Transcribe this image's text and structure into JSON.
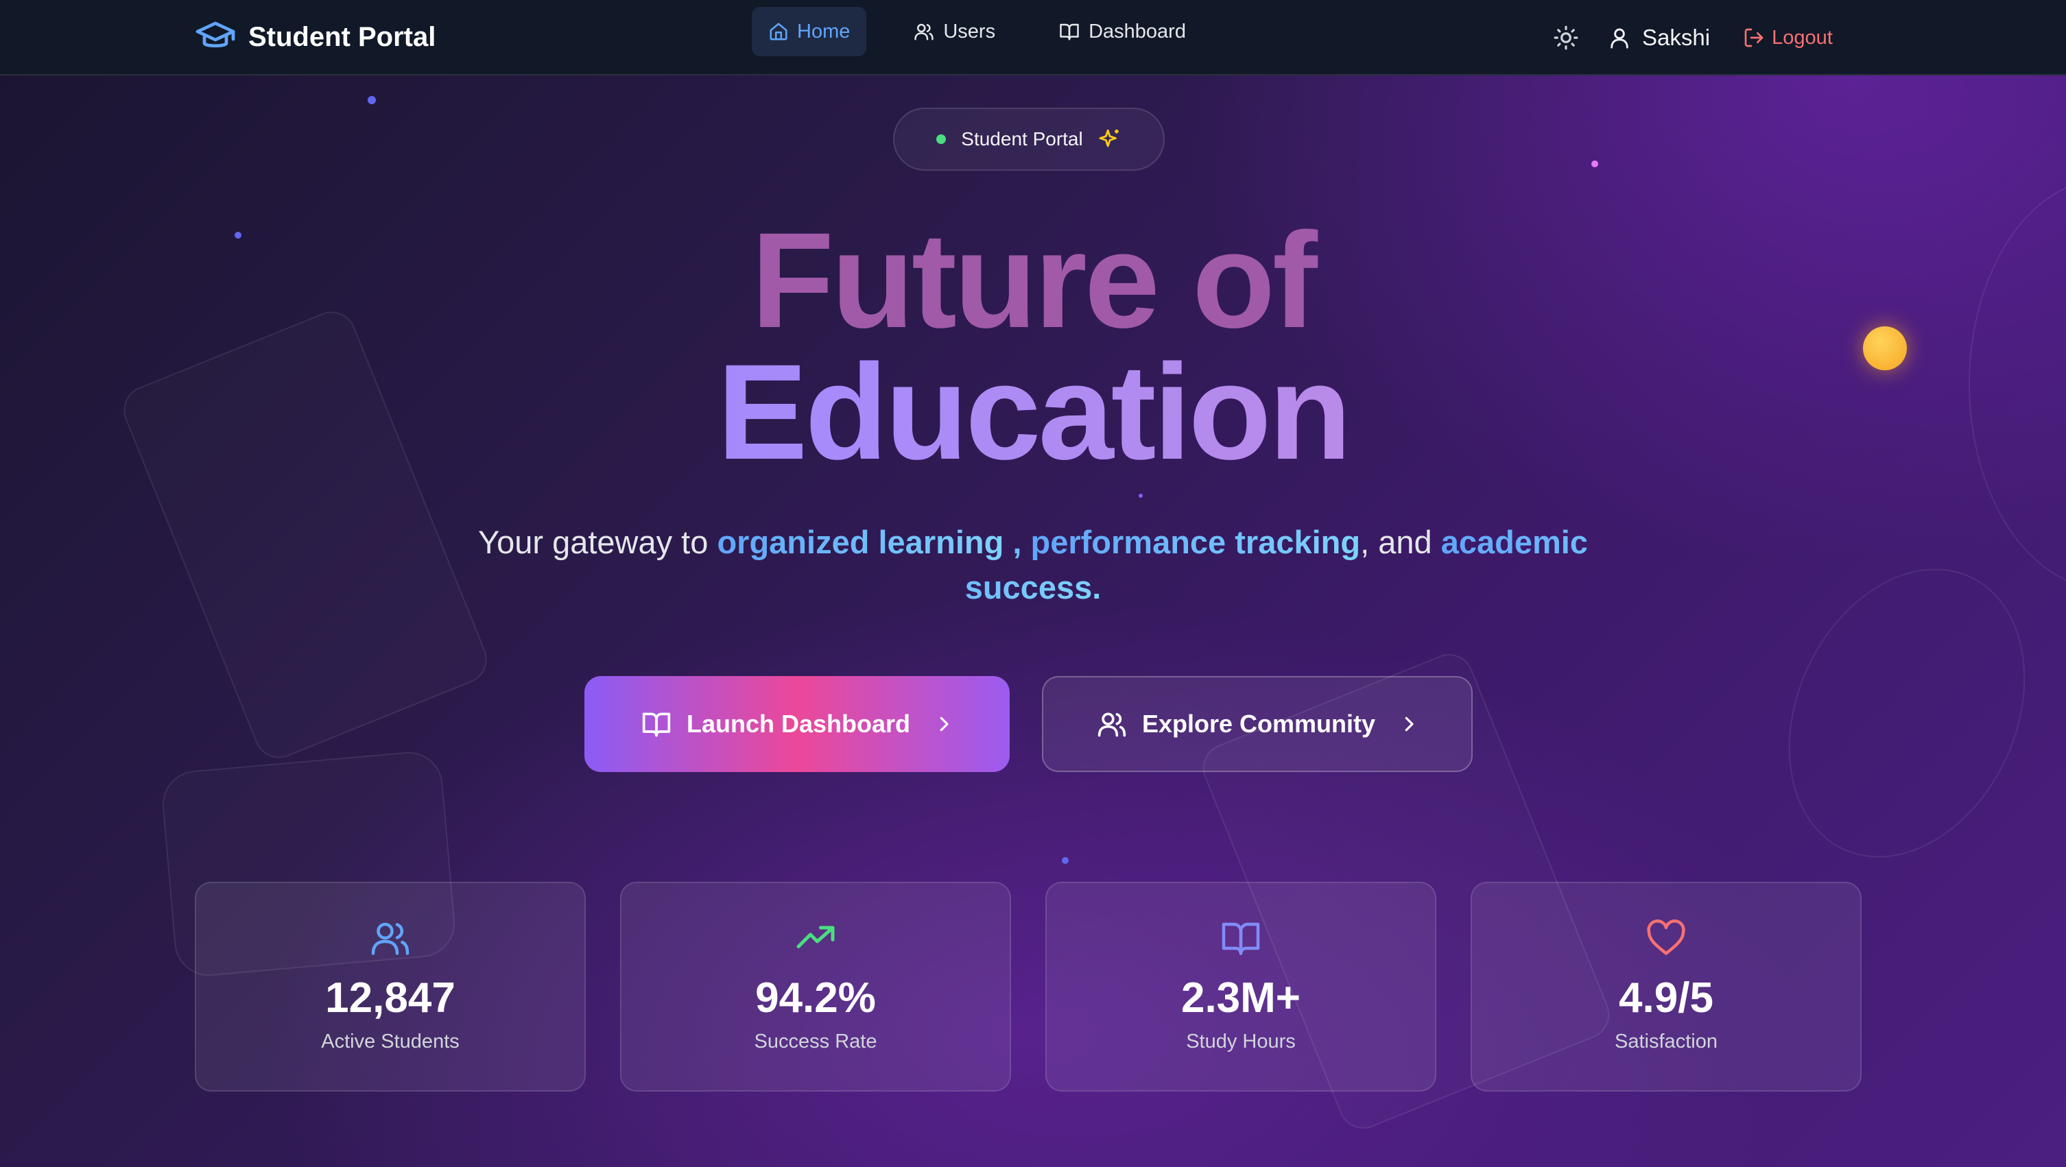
{
  "app": {
    "brand": "Student Portal",
    "user_name": "Sakshi",
    "logout_label": "Logout"
  },
  "nav": {
    "items": [
      {
        "label": "Home",
        "icon": "home-icon",
        "active": true
      },
      {
        "label": "Users",
        "icon": "users-icon",
        "active": false
      },
      {
        "label": "Dashboard",
        "icon": "book-icon",
        "active": false
      }
    ]
  },
  "hero": {
    "badge": "Student Portal",
    "headline_line1": "Future of",
    "headline_line2": "Education",
    "subtitle_prefix": "Your gateway to ",
    "subtitle_hl1": "organized learning",
    "subtitle_sep1": " , ",
    "subtitle_hl2": "performance tracking",
    "subtitle_sep2": ", and ",
    "subtitle_hl3": "academic success."
  },
  "actions": {
    "primary": "Launch Dashboard",
    "secondary": "Explore Community"
  },
  "stats": [
    {
      "value": "12,847",
      "label": "Active Students",
      "icon": "users-icon",
      "color": "#60a5fa"
    },
    {
      "value": "94.2%",
      "label": "Success Rate",
      "icon": "trending-up-icon",
      "color": "#4ade80"
    },
    {
      "value": "2.3M+",
      "label": "Study Hours",
      "icon": "book-icon",
      "color": "#818cf8"
    },
    {
      "value": "4.9/5",
      "label": "Satisfaction",
      "icon": "heart-icon",
      "color": "#f87171"
    }
  ],
  "colors": {
    "nav_bg": "#111827",
    "accent_blue": "#60a5fa",
    "logout_red": "#f87171",
    "primary_gradient": [
      "#8b5cf6",
      "#ec4899"
    ]
  }
}
